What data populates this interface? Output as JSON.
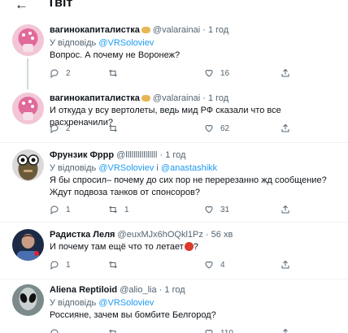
{
  "header": {
    "back_icon": "arrow-left-icon",
    "title": "Твіт"
  },
  "tweets": [
    {
      "name": "вагинокапиталистка",
      "handle": "@valarainai",
      "sep": "·",
      "time": "1 год",
      "reply_prefix": "У відповідь ",
      "reply_to": "@VRSoloviev",
      "text": "Вопрос. А почему не Воронеж?",
      "replies": "2",
      "retweets": "",
      "likes": "16"
    },
    {
      "name": "вагинокапиталистка",
      "handle": "@valarainai",
      "sep": "·",
      "time": "1 год",
      "text": "И откуда у всу вертолеты, ведь мид РФ сказали что все расхреначили?",
      "replies": "2",
      "retweets": "",
      "likes": "62"
    },
    {
      "name": "Фрунзик Фррр",
      "handle": "@llllllllllllllll",
      "sep": "·",
      "time": "1 год",
      "reply_prefix": "У відповідь ",
      "reply_to": "@VRSoloviev",
      "reply_mid": " і ",
      "reply_to2": "@anastashikk",
      "text": "Я бы спросил– почему до сих пор не перерезанно жд сообщение? Ждут подвоза танков от спонсоров?",
      "replies": "1",
      "retweets": "1",
      "likes": "31"
    },
    {
      "name": "Радистка Леля",
      "handle": "@euxMJx6hOQkl1Pz",
      "sep": "·",
      "time": "56 хв",
      "text": "И почему там ещё что то летает",
      "text_after": "?",
      "replies": "1",
      "retweets": "",
      "likes": "4"
    },
    {
      "name": "Aliena Reptiloid",
      "handle": "@alio_lia",
      "sep": "·",
      "time": "1 год",
      "reply_prefix": "У відповідь ",
      "reply_to": "@VRSoloviev",
      "text": "Россияне, зачем вы бомбите Белгород?",
      "replies": "",
      "retweets": "",
      "likes": "110"
    }
  ],
  "colors": {
    "link": "#1d9bf0",
    "muted": "#536471",
    "text": "#0f1419",
    "line": "#cfd9de"
  }
}
